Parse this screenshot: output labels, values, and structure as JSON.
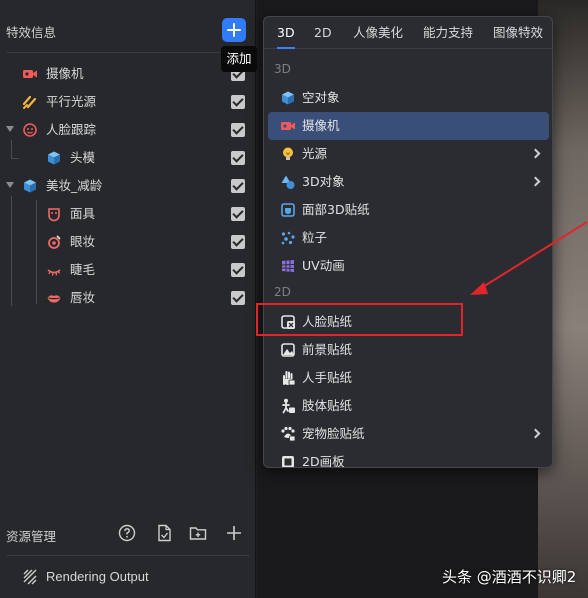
{
  "effects_panel": {
    "title": "特效信息",
    "add_tooltip": "添加",
    "layers": [
      {
        "label": "摄像机",
        "icon": "camera-icon",
        "checked": true
      },
      {
        "label": "平行光源",
        "icon": "directional-light-icon",
        "checked": true
      },
      {
        "label": "人脸跟踪",
        "icon": "face-tracking-icon",
        "checked": true,
        "expanded": true
      },
      {
        "label": "头模",
        "icon": "head-model-cube-icon",
        "checked": true
      },
      {
        "label": "美妆_减龄",
        "icon": "makeup-cube-icon",
        "checked": true,
        "expanded": true
      },
      {
        "label": "面具",
        "icon": "mask-icon",
        "checked": true
      },
      {
        "label": "眼妆",
        "icon": "eye-makeup-icon",
        "checked": true
      },
      {
        "label": "睫毛",
        "icon": "eyelash-icon",
        "checked": true
      },
      {
        "label": "唇妆",
        "icon": "lips-icon",
        "checked": true
      }
    ]
  },
  "resource_panel": {
    "title": "资源管理",
    "icons": [
      "help-icon",
      "import-file-icon",
      "new-folder-icon",
      "add-icon"
    ],
    "rendering_output": "Rendering Output"
  },
  "add_menu": {
    "tabs": [
      "3D",
      "2D",
      "人像美化",
      "能力支持",
      "图像特效"
    ],
    "active_tab": "3D",
    "section_3d": "3D",
    "items_3d": [
      {
        "label": "空对象",
        "icon": "empty-object-cube-icon"
      },
      {
        "label": "摄像机",
        "icon": "camera-icon",
        "selected": true
      },
      {
        "label": "光源",
        "icon": "light-bulb-icon",
        "submenu": true
      },
      {
        "label": "3D对象",
        "icon": "shapes-icon",
        "submenu": true
      },
      {
        "label": "面部3D贴纸",
        "icon": "face-3d-sticker-icon"
      },
      {
        "label": "粒子",
        "icon": "particles-icon"
      },
      {
        "label": "UV动画",
        "icon": "uv-animation-icon"
      }
    ],
    "section_2d": "2D",
    "items_2d": [
      {
        "label": "人脸贴纸",
        "icon": "face-sticker-icon"
      },
      {
        "label": "前景贴纸",
        "icon": "foreground-sticker-icon"
      },
      {
        "label": "人手贴纸",
        "icon": "hand-sticker-icon"
      },
      {
        "label": "肢体贴纸",
        "icon": "body-sticker-icon"
      },
      {
        "label": "宠物脸贴纸",
        "icon": "pet-face-sticker-icon",
        "submenu": true
      },
      {
        "label": "2D画板",
        "icon": "canvas-2d-icon"
      }
    ]
  },
  "watermark": "头条 @酒酒不识卿2",
  "colors": {
    "accent": "#2f7cf6",
    "selected_bg": "#3a4e7a",
    "annotation_red": "#e0262a"
  }
}
